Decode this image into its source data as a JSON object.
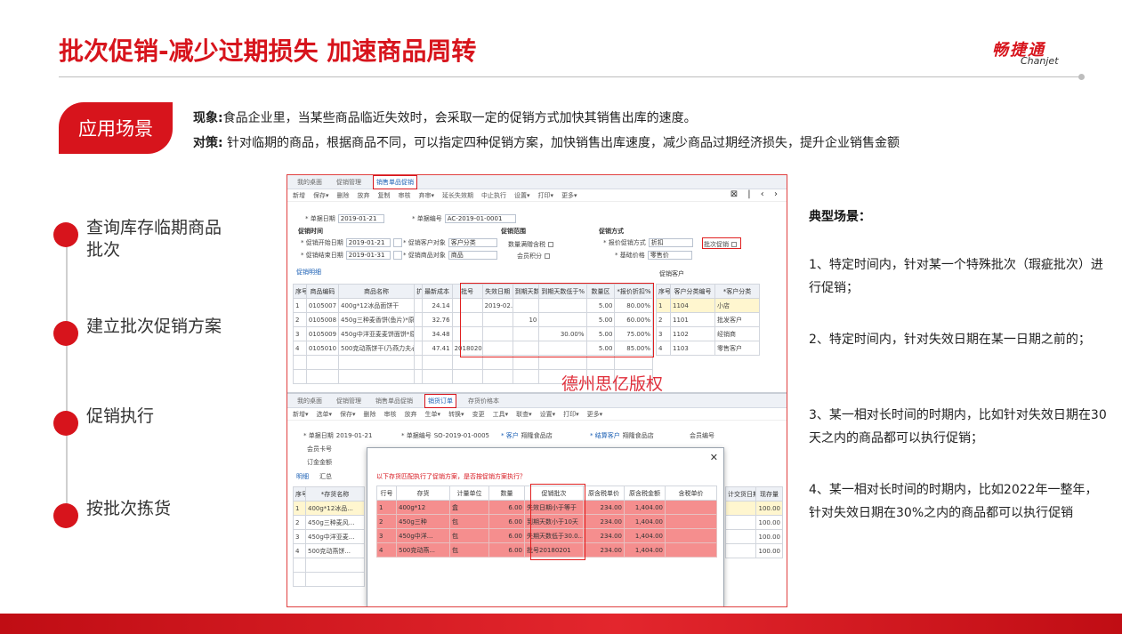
{
  "title": "批次促销-减少过期损失 加速商品周转",
  "logo": {
    "cn": "畅捷通",
    "en": "Chanjet"
  },
  "scene": {
    "badge": "应用场景",
    "line1_label": "现象:",
    "line1_text": "食品企业里，当某些商品临近失效时，会采取一定的促销方式加快其销售出库的速度。",
    "line2_label": "对策:",
    "line2_text": " 针对临期的商品，根据商品不同，可以指定四种促销方案，加快销售出库速度，减少商品过期经济损失，提升企业销售金额"
  },
  "steps": [
    {
      "label": "查询库存临期商品批次"
    },
    {
      "label": "建立批次促销方案"
    },
    {
      "label": "促销执行"
    },
    {
      "label": "按批次拣货"
    }
  ],
  "screenshot": {
    "watermark": "德州思亿版权",
    "top": {
      "tabs": [
        "我的桌面",
        "促销管理",
        "销售单品促销"
      ],
      "toolbar": [
        "新增",
        "保存▾",
        "删除",
        "放弃",
        "复制",
        "审核",
        "弃审▾",
        "延长失效期",
        "中止执行",
        "设置▾",
        "打印▾",
        "更多▾"
      ],
      "toolbar_right": "⊠ | ‹ ›",
      "form": {
        "doc_date_label": "* 单据日期",
        "doc_date": "2019-01-21",
        "doc_no_label": "* 单据编号",
        "doc_no": "AC-2019-01-0001",
        "time_section": "促销时间",
        "start_label": "* 促销开始日期",
        "start": "2019-01-21",
        "end_label": "* 促销结束日期",
        "end": "2019-01-31",
        "obj_label": "* 促销客户对象",
        "obj": "客户分类",
        "goods_label": "* 促销商品对象",
        "goods": "商品",
        "range_section": "促销范围",
        "rule1": "数量满赠含税",
        "rule2": "会员积分",
        "method_section": "促销方式",
        "price_label": "* 报价促销方式",
        "price": "折扣",
        "basis_label": "* 基础价格",
        "basis": "零售价",
        "batch_label": "批次促销"
      },
      "sub_tab": "促销明细",
      "grid_headers": [
        "序号",
        "商品编码",
        "商品名称",
        "扩",
        "最新成本",
        "批号",
        "失效日期",
        "到期天数",
        "到期天数低于%",
        "数量区",
        "*报价折扣%"
      ],
      "grid_rows": [
        [
          "1",
          "0105007",
          "400g*12冰品面饼干",
          "",
          "24.14",
          "",
          "2019-02...",
          "",
          "",
          "5.00",
          "80.00%"
        ],
        [
          "2",
          "0105008",
          "450g三种麦香饼(鱼片)*原点",
          "",
          "32.76",
          "",
          "",
          "10",
          "",
          "5.00",
          "60.00%"
        ],
        [
          "3",
          "0105009",
          "450g中洋亚麦麦饼面饼*原点",
          "",
          "34.48",
          "",
          "",
          "",
          "30.00%",
          "5.00",
          "75.00%"
        ],
        [
          "4",
          "0105010",
          "500克动燕饼干(乃燕力夫心)",
          "",
          "47.41",
          "20180201",
          "",
          "",
          "",
          "5.00",
          "85.00%"
        ]
      ],
      "cust_section": "促销客户",
      "cust_headers": [
        "序号",
        "客户分类编号",
        "*客户分类"
      ],
      "cust_rows": [
        [
          "1",
          "1104",
          "小店"
        ],
        [
          "2",
          "1101",
          "批发客户"
        ],
        [
          "3",
          "1102",
          "经销商"
        ],
        [
          "4",
          "1103",
          "零售客户"
        ]
      ]
    },
    "bottom": {
      "tabs": [
        "我的桌面",
        "促销管理",
        "销售单品促销",
        "销货订单",
        "存货价格本"
      ],
      "toolbar": [
        "新增▾",
        "选单▾",
        "保存▾",
        "删除",
        "审核",
        "放弃",
        "生单▾",
        "转换▾",
        "变更",
        "工具▾",
        "联查▾",
        "设置▾",
        "打印▾",
        "更多▾"
      ],
      "doc_date_label": "* 单据日期",
      "doc_date": "2019-01-21",
      "doc_no_label": "* 单据编号",
      "doc_no": "SO-2019-01-0005",
      "customer_label": "* 客户",
      "customer": "翔隆食品店",
      "settle_label": "* 结算客户",
      "settle": "翔隆食品店",
      "member_label": "会员编号",
      "card_label": "会员卡号",
      "deposit_label": "订金金额",
      "sub_tabs": [
        "明细",
        "汇总"
      ],
      "left_headers": [
        "序号",
        "*存货名称"
      ],
      "left_rows": [
        [
          "1",
          "400g*12冰品..."
        ],
        [
          "2",
          "450g三种麦风..."
        ],
        [
          "3",
          "450g中洋亚麦..."
        ],
        [
          "4",
          "500克动燕饼..."
        ]
      ],
      "right_headers": [
        "计交货日期",
        "现存量"
      ],
      "right_rows": [
        [
          "",
          "100.00"
        ],
        [
          "",
          "100.00"
        ],
        [
          "",
          "100.00"
        ],
        [
          "",
          "100.00"
        ]
      ],
      "dialog": {
        "note": "以下存货匹配执行了促销方案，是否按促销方案执行？",
        "headers": [
          "行号",
          "存货",
          "计量单位",
          "数量",
          "促销批次",
          "原含税单价",
          "原含税金额",
          "含税单价"
        ],
        "rows": [
          [
            "1",
            "400g*12",
            "盒",
            "6.00",
            "失效日期小于等于",
            "234.00",
            "1,404.00",
            ""
          ],
          [
            "2",
            "450g三种",
            "包",
            "6.00",
            "到期天数小于10天",
            "234.00",
            "1,404.00",
            ""
          ],
          [
            "3",
            "450g中洋...",
            "包",
            "6.00",
            "失期天数低于30.0...",
            "234.00",
            "1,404.00",
            ""
          ],
          [
            "4",
            "500克动燕...",
            "包",
            "6.00",
            "批号20180201",
            "234.00",
            "1,404.00",
            ""
          ]
        ]
      }
    }
  },
  "right": {
    "title": "典型场景：",
    "items": [
      "1、特定时间内，针对某一个特殊批次（瑕疵批次）进行促销；",
      "2、特定时间内，针对失效日期在某一日期之前的；",
      "3、某一相对长时间的时期内，比如针对失效日期在30天之内的商品都可以执行促销；",
      "4、某一相对长时间的时期内，比如2022年一整年，针对失效日期在30%之内的商品都可以执行促销"
    ]
  },
  "colors": {
    "accent": "#d7141c",
    "highlight_row": "#f58e8e"
  }
}
